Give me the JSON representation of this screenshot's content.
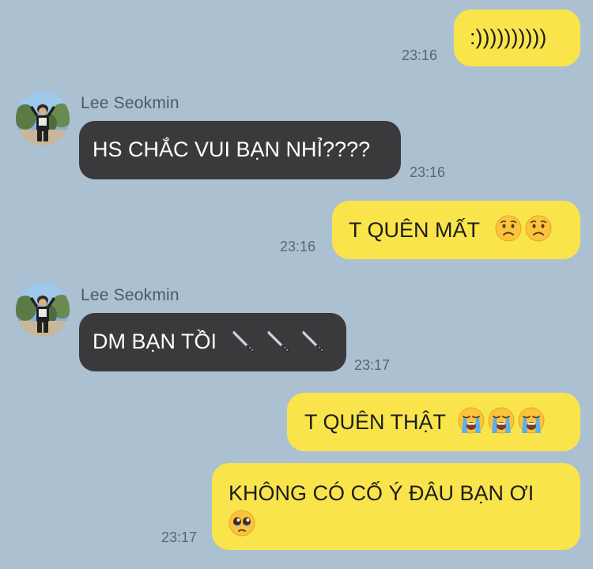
{
  "contact": {
    "name": "Lee Seokmin"
  },
  "messages": [
    {
      "id": "m1",
      "direction": "outgoing",
      "text": ":))))))))))",
      "time": "23:16",
      "emoji": []
    },
    {
      "id": "m2",
      "direction": "incoming",
      "text": "HS CHẮC VUI BẠN NHỈ????",
      "time": "23:16",
      "emoji": []
    },
    {
      "id": "m3",
      "direction": "outgoing",
      "text": "T QUÊN MẤT",
      "time": "23:16",
      "emoji": [
        "worried-face",
        "worried-face"
      ]
    },
    {
      "id": "m4",
      "direction": "incoming",
      "text": "DM BẠN TỒI",
      "time": "23:17",
      "emoji": [
        "kitchen-knife",
        "kitchen-knife",
        "kitchen-knife"
      ]
    },
    {
      "id": "m5",
      "direction": "outgoing",
      "text": "T QUÊN THẬT",
      "time": "",
      "emoji": [
        "loudly-crying-face",
        "loudly-crying-face",
        "loudly-crying-face"
      ]
    },
    {
      "id": "m6",
      "direction": "outgoing",
      "text": "KHÔNG CÓ CỐ Ý ĐÂU BẠN ƠI",
      "time": "23:17",
      "emoji": [
        "pleading-face"
      ]
    }
  ],
  "colors": {
    "background": "#abc1d1",
    "outgoing_bubble": "#f9e54b",
    "incoming_bubble": "#3a3a3c",
    "timestamp": "#5a6670"
  }
}
